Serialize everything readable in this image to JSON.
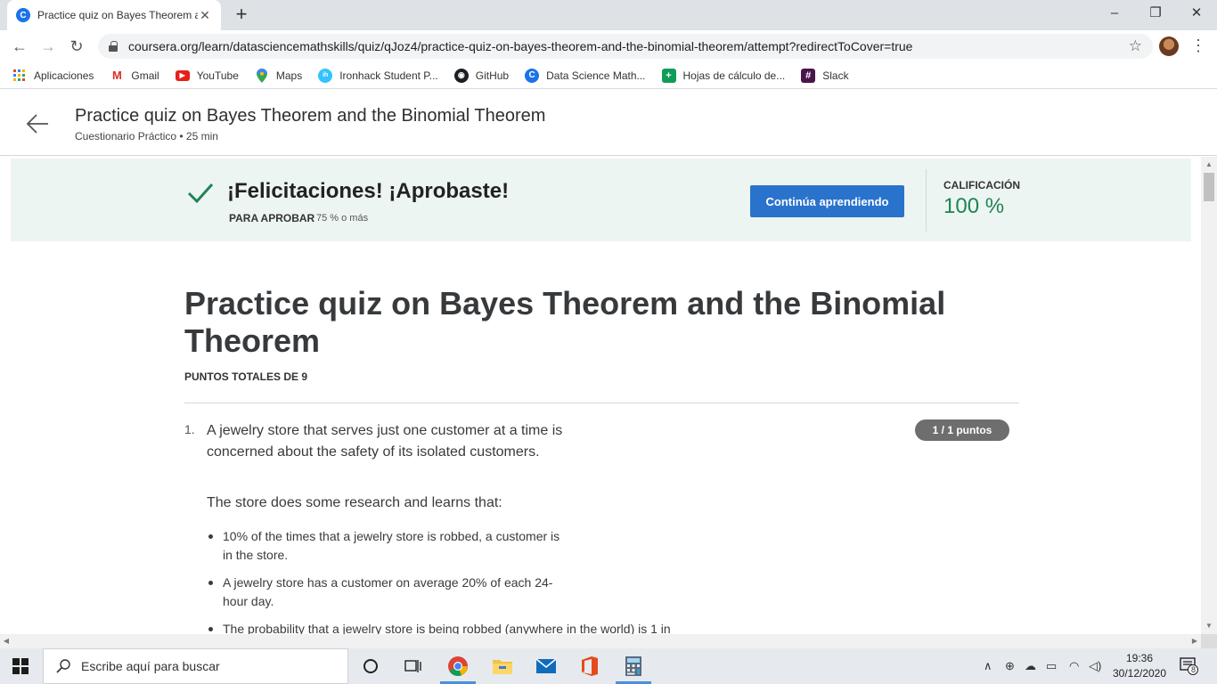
{
  "browser": {
    "tab_title": "Practice quiz on Bayes Theorem a",
    "url": "coursera.org/learn/datasciencemathskills/quiz/qJoz4/practice-quiz-on-bayes-theorem-and-the-binomial-theorem/attempt?redirectToCover=true",
    "window_controls": {
      "minimize": "–",
      "maximize": "❐",
      "close": "✕"
    },
    "bookmarks": [
      {
        "label": "Aplicaciones",
        "icon": "apps-grid-icon"
      },
      {
        "label": "Gmail",
        "icon": "gmail-icon"
      },
      {
        "label": "YouTube",
        "icon": "youtube-icon"
      },
      {
        "label": "Maps",
        "icon": "maps-pin-icon"
      },
      {
        "label": "Ironhack Student P...",
        "icon": "ironhack-icon"
      },
      {
        "label": "GitHub",
        "icon": "github-icon"
      },
      {
        "label": "Data Science Math...",
        "icon": "coursera-icon"
      },
      {
        "label": "Hojas de cálculo de...",
        "icon": "sheets-icon"
      },
      {
        "label": "Slack",
        "icon": "slack-icon"
      }
    ]
  },
  "header": {
    "title": "Practice quiz on Bayes Theorem and the Binomial Theorem",
    "subtitle": "Cuestionario Práctico • 25 min"
  },
  "banner": {
    "heading": "¡Felicitaciones! ¡Aprobaste!",
    "pass_label": "PARA APROBAR",
    "pass_value": "75 % o más",
    "continue_label": "Continúa aprendiendo",
    "grade_label": "CALIFICACIÓN",
    "grade_value": "100 %",
    "accent_color": "#1f8354",
    "button_color": "#2a73cc"
  },
  "quiz": {
    "title": "Practice quiz on Bayes Theorem and the Binomial Theorem",
    "total_points": "PUNTOS TOTALES DE 9",
    "question": {
      "number": "1.",
      "text": "A jewelry store that serves just one customer at a time is concerned about the safety of its isolated customers.",
      "points": "1 / 1 puntos",
      "intro": "The store does some research and learns that:",
      "bullets": [
        "10% of the times that a jewelry store is robbed, a customer is in the store.",
        "A jewelry store has a customer on average 20% of each 24-hour day.",
        "The probability that a jewelry store is being robbed (anywhere in the world) is 1 in"
      ]
    }
  },
  "taskbar": {
    "search_placeholder": "Escribe aquí para buscar",
    "time": "19:36",
    "date": "30/12/2020",
    "notification_count": "8"
  }
}
